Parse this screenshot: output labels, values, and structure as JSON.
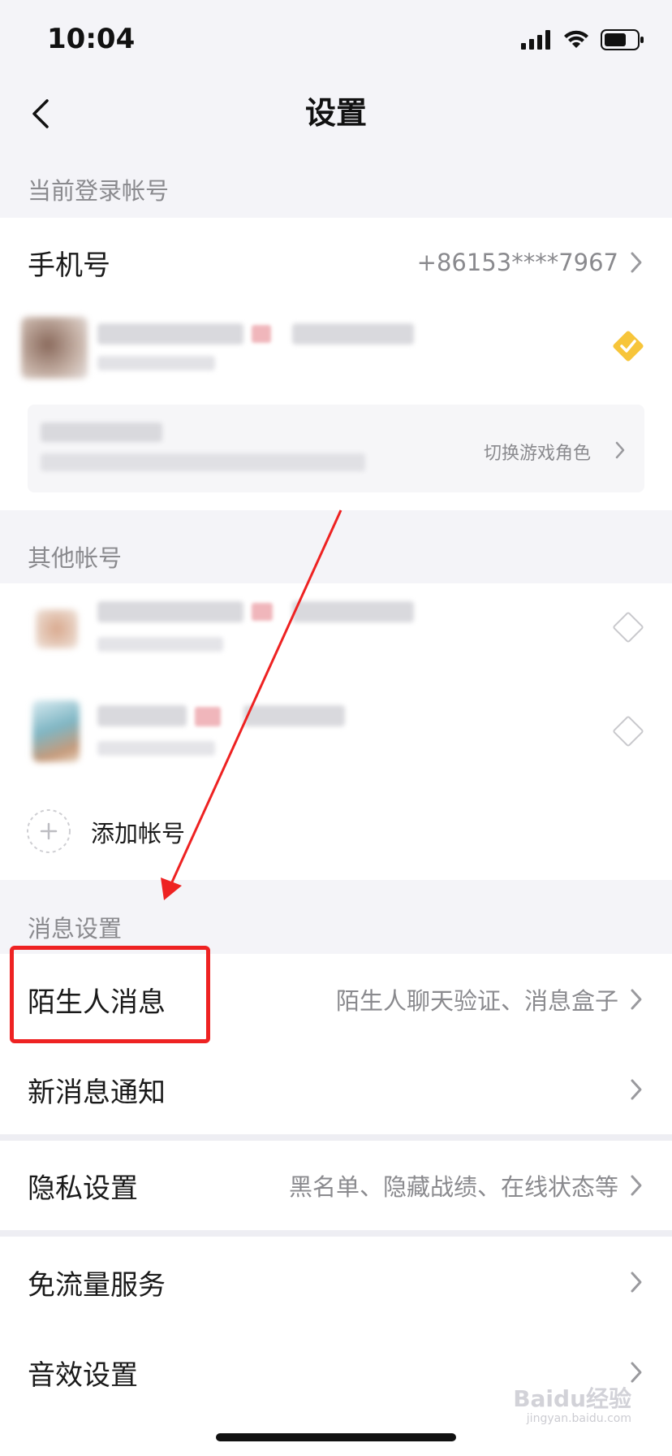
{
  "status": {
    "time": "10:04"
  },
  "nav": {
    "title": "设置"
  },
  "sections": {
    "current_account": "当前登录帐号",
    "other_accounts": "其他帐号",
    "message_settings": "消息设置"
  },
  "current_account": {
    "phone_label": "手机号",
    "phone_value": "+86153****7967",
    "switch_role_label": "切换游戏角色"
  },
  "other_accounts": {
    "add_account_label": "添加帐号"
  },
  "settings": {
    "stranger_messages_label": "陌生人消息",
    "stranger_messages_value": "陌生人聊天验证、消息盒子",
    "new_message_label": "新消息通知",
    "privacy_label": "隐私设置",
    "privacy_value": "黑名单、隐藏战绩、在线状态等",
    "data_free_label": "免流量服务",
    "sound_label": "音效设置"
  },
  "watermark": {
    "main": "Baidu经验",
    "sub": "jingyan.baidu.com"
  },
  "colors": {
    "accent_check": "#f7c53a",
    "annotation": "#ee2222"
  }
}
